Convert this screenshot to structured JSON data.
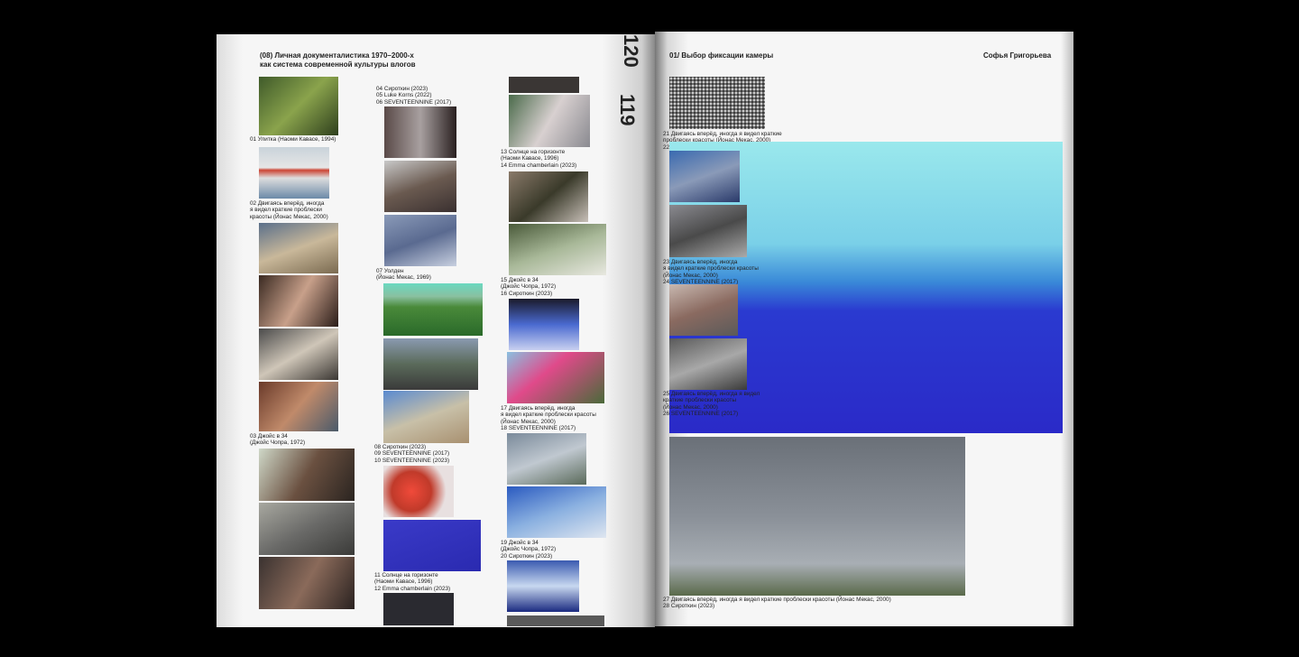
{
  "left_page": {
    "header": "(08)  Личная документалистика 1970–2000-х\n        как система современной культуры влогов",
    "page_top": "120",
    "page_side": "119"
  },
  "right_page": {
    "header": "01/ Выбор фиксации камеры",
    "author": "Софья Григорьева"
  },
  "captions": [
    "01 Улитка (Наоми Кавасе, 1994)",
    "02 Двигаясь вперёд, иногда\n      я видел краткие проблески\n      красоты (Йонас Мекас, 2000)",
    "03 Джойс в 34\n      (Джойс Чопра, 1972)",
    "04 Сироткин (2023)\n05 Luke Korns (2022)\n06 SEVENTEENNINE (2017)",
    "07 Уолден\n      (Йонас Мекас, 1969)",
    "08 Сироткин (2023)\n09 SEVENTEENNINE (2017)\n10 SEVENTEENNINE (2023)",
    "11 Солнце на горизонте\n      (Наоми Кавасе, 1996)\n12 Emma chamberlain (2023)",
    "13 Солнце на горизонте\n      (Наоми Кавасе, 1996)\n14 Emma chamberlain (2023)",
    "15 Джойс в 34\n      (Джойс Чопра, 1972)\n16 Сироткин (2023)",
    "17 Двигаясь вперёд, иногда\n      я видел краткие проблески красоты\n      (Йонас Мекас, 2000)\n18 SEVENTEENNINE (2017)",
    "19 Джойс в 34\n      (Джойс Чопра, 1972)\n20 Сироткин (2023)",
    "21 Двигаясь вперёд, иногда я видел краткие\n     проблески красоты (Йонас Мекас, 2000)\n22 Сироткин (2023)",
    "23 Двигаясь вперёд, иногда\n     я видел краткие проблески красоты\n     (Йонас Мекас, 2000)\n24 SEVENTEENNINE (2017)",
    "25 Двигаясь вперёд, иногда я видел\n     краткие проблески красоты\n     (Йонас Мекас, 2000)\n26 SEVENTEENNINE (2017)",
    "27 Двигаясь вперёд, иногда я видел краткие проблески красоты (Йонас Мекас, 2000)\n28 Сироткин (2023)"
  ]
}
